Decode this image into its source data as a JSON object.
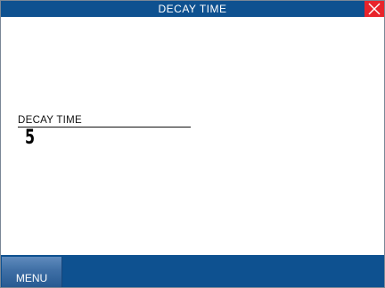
{
  "window": {
    "title": "DECAY TIME"
  },
  "icons": {
    "close": "close-icon"
  },
  "parameter": {
    "label": "DECAY TIME",
    "value": "5"
  },
  "bottom_bar": {
    "menu_label": "MENU"
  },
  "colors": {
    "title_bar": "#0e5190",
    "close_button": "#e8242b",
    "bottom_bar": "#0e5190",
    "menu_button": "#3f6fa5"
  }
}
